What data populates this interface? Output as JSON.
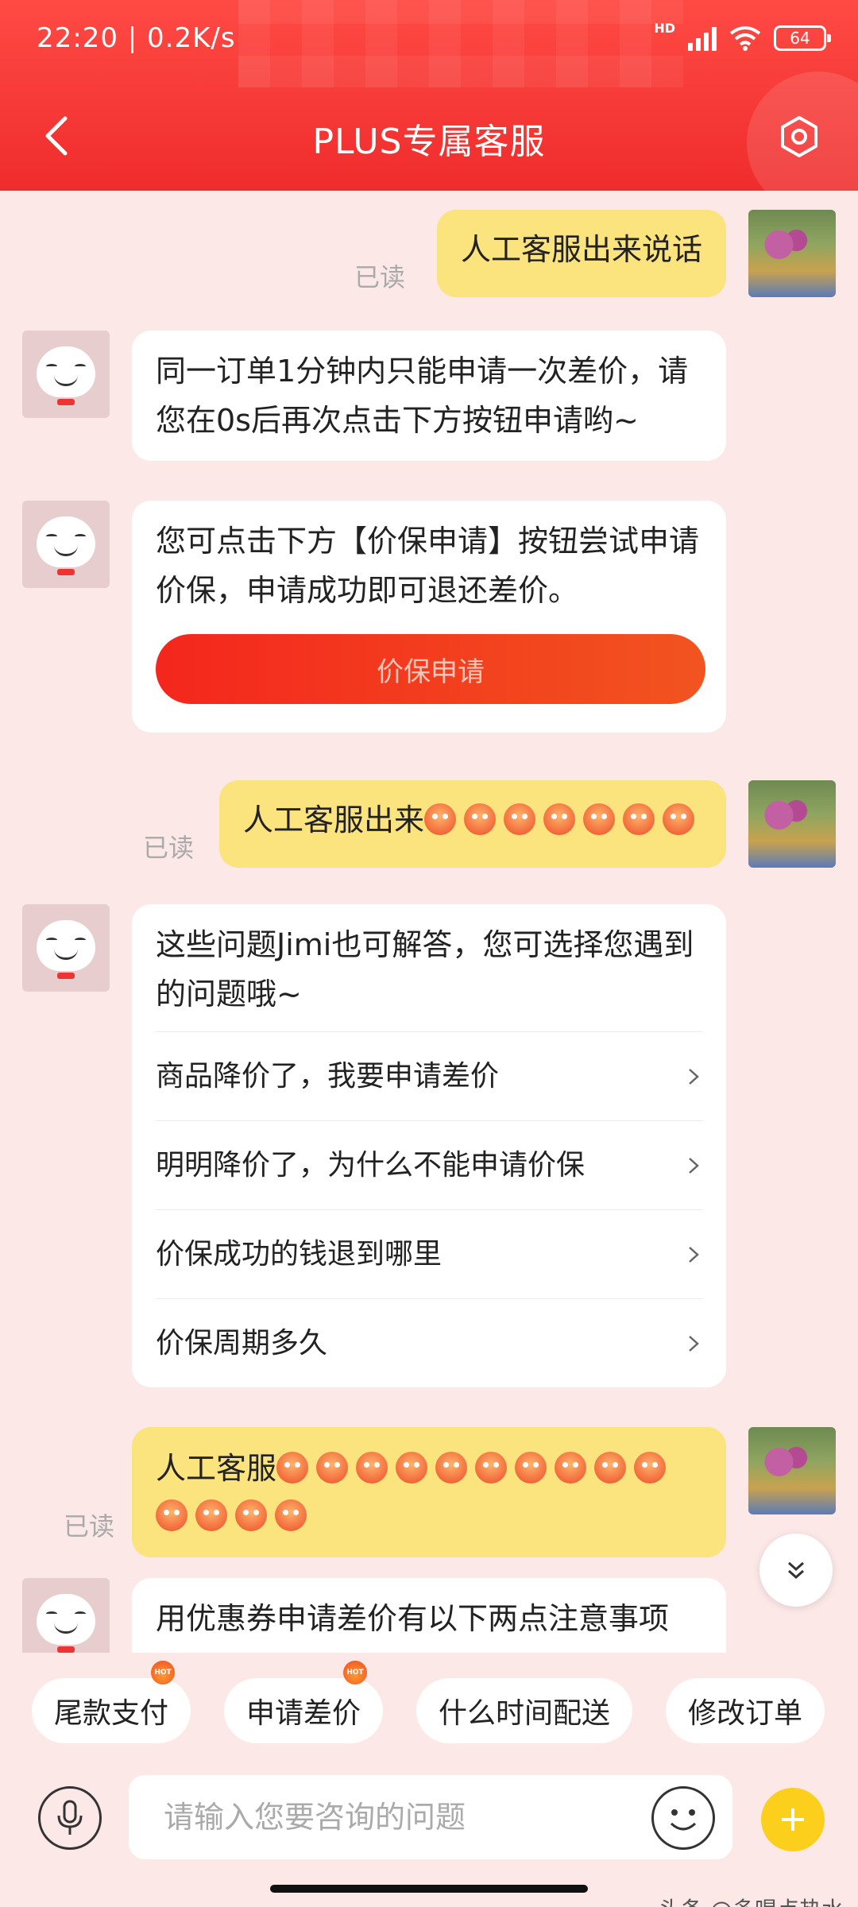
{
  "status_bar": {
    "time": "22:20 | 0.2K/s",
    "network": "HD",
    "battery": "64"
  },
  "header": {
    "title": "PLUS专属客服"
  },
  "messages": {
    "m1": {
      "text": "人工客服出来说话",
      "read": "已读"
    },
    "m2": {
      "text": "同一订单1分钟内只能申请一次差价，请您在0s后再次点击下方按钮申请哟~"
    },
    "m3": {
      "text": "您可点击下方【价保申请】按钮尝试申请价保，申请成功即可退还差价。",
      "button": "价保申请"
    },
    "m4": {
      "text": "人工客服出来",
      "read": "已读"
    },
    "m5": {
      "text": "这些问题Jimi也可解答，您可选择您遇到的问题哦~",
      "options": [
        "商品降价了，我要申请差价",
        "明明降价了，为什么不能申请价保",
        "价保成功的钱退到哪里",
        "价保周期多久"
      ]
    },
    "m6": {
      "text": "人工客服",
      "read": "已读"
    },
    "m7": {
      "text": "用优惠券申请差价有以下两点注意事项"
    }
  },
  "quick_replies": [
    {
      "label": "尾款支付",
      "hot": "HOT"
    },
    {
      "label": "申请差价",
      "hot": "HOT"
    },
    {
      "label": "什么时间配送"
    },
    {
      "label": "修改订单"
    }
  ],
  "input": {
    "placeholder": "请输入您要咨询的问题"
  },
  "watermark": "头条 @多喝点热水"
}
